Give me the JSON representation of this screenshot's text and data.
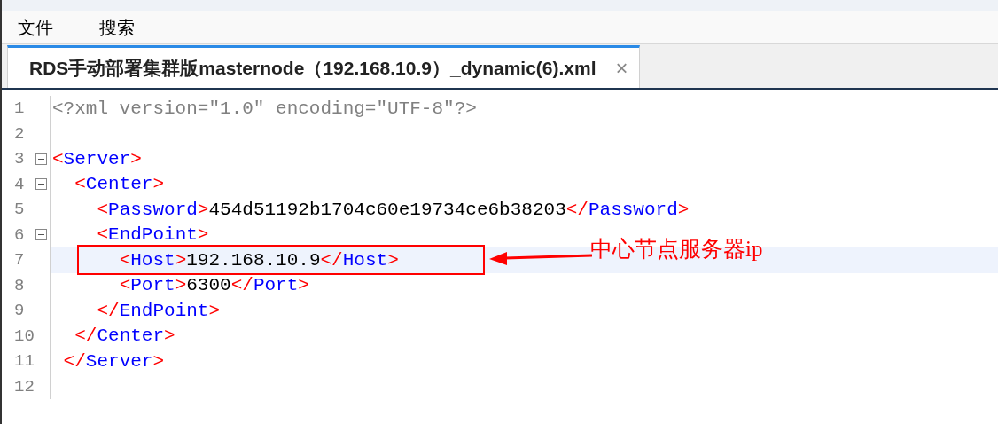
{
  "menu": [
    {
      "label": "文件"
    },
    {
      "label": "搜索"
    }
  ],
  "tabs": [
    {
      "title": "RDS手动部署集群版masternode（192.168.10.9）_dynamic(6).xml",
      "close": "×",
      "selected": true
    }
  ],
  "editor": {
    "lines": [
      {
        "number": "1",
        "foldable": false,
        "current": false,
        "tokens": [
          {
            "kind": "decl",
            "text": "<?xml version=\"1.0\" encoding=\"UTF-8\"?>"
          }
        ]
      },
      {
        "number": "2",
        "foldable": false,
        "current": false
      },
      {
        "number": "3",
        "foldable": true,
        "current": false,
        "tokens": [
          {
            "kind": "punct",
            "text": "<"
          },
          {
            "kind": "name",
            "text": "Server"
          },
          {
            "kind": "punct",
            "text": ">"
          }
        ]
      },
      {
        "number": "4",
        "foldable": true,
        "current": false,
        "tokens": [
          {
            "kind": "punct",
            "text": "  <"
          },
          {
            "kind": "name",
            "text": "Center"
          },
          {
            "kind": "punct",
            "text": ">"
          }
        ]
      },
      {
        "number": "5",
        "foldable": false,
        "current": false,
        "tokens": [
          {
            "kind": "punct",
            "text": "    <"
          },
          {
            "kind": "name",
            "text": "Password"
          },
          {
            "kind": "punct",
            "text": ">"
          },
          {
            "kind": "text",
            "text": "454d51192b1704c60e19734ce6b38203"
          },
          {
            "kind": "punct",
            "text": "</"
          },
          {
            "kind": "name",
            "text": "Password"
          },
          {
            "kind": "punct",
            "text": ">"
          }
        ]
      },
      {
        "number": "6",
        "foldable": true,
        "current": false,
        "tokens": [
          {
            "kind": "punct",
            "text": "    <"
          },
          {
            "kind": "name",
            "text": "EndPoint"
          },
          {
            "kind": "punct",
            "text": ">"
          }
        ]
      },
      {
        "number": "7",
        "foldable": false,
        "current": true,
        "tokens": [
          {
            "kind": "punct",
            "text": "      <"
          },
          {
            "kind": "name",
            "text": "Host"
          },
          {
            "kind": "punct",
            "text": ">"
          },
          {
            "kind": "text",
            "text": "192.168.10.9"
          },
          {
            "kind": "punct",
            "text": "</"
          },
          {
            "kind": "name",
            "text": "Host"
          },
          {
            "kind": "punct",
            "text": ">"
          }
        ]
      },
      {
        "number": "8",
        "foldable": false,
        "current": false,
        "tokens": [
          {
            "kind": "punct",
            "text": "      <"
          },
          {
            "kind": "name",
            "text": "Port"
          },
          {
            "kind": "punct",
            "text": ">"
          },
          {
            "kind": "text",
            "text": "6300"
          },
          {
            "kind": "punct",
            "text": "</"
          },
          {
            "kind": "name",
            "text": "Port"
          },
          {
            "kind": "punct",
            "text": ">"
          }
        ]
      },
      {
        "number": "9",
        "foldable": false,
        "current": false,
        "tokens": [
          {
            "kind": "punct",
            "text": "    </"
          },
          {
            "kind": "name",
            "text": "EndPoint"
          },
          {
            "kind": "punct",
            "text": ">"
          }
        ]
      },
      {
        "number": "10",
        "foldable": false,
        "current": false,
        "tokens": [
          {
            "kind": "punct",
            "text": "  </"
          },
          {
            "kind": "name",
            "text": "Center"
          },
          {
            "kind": "punct",
            "text": ">"
          }
        ]
      },
      {
        "number": "11",
        "foldable": false,
        "current": false,
        "tokens": [
          {
            "kind": "punct",
            "text": " </"
          },
          {
            "kind": "name",
            "text": "Server"
          },
          {
            "kind": "punct",
            "text": ">"
          }
        ]
      },
      {
        "number": "12",
        "foldable": false,
        "current": false
      }
    ]
  },
  "annotation": {
    "label": "中心节点服务器ip"
  }
}
